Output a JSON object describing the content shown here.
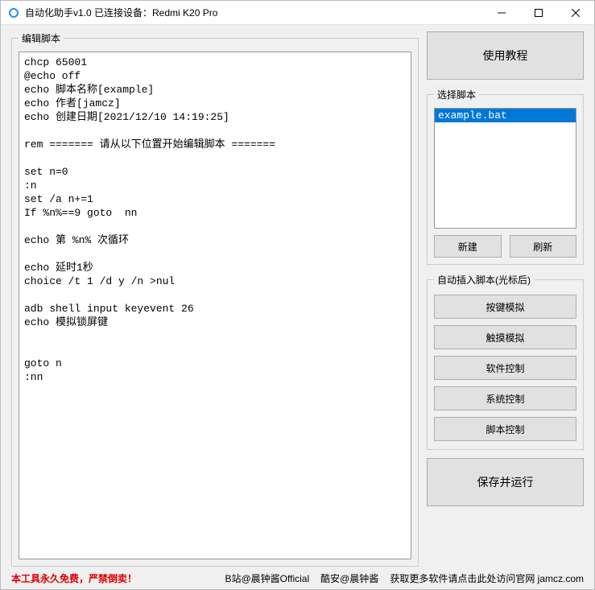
{
  "title": "自动化助手v1.0  已连接设备：Redmi K20 Pro",
  "editor": {
    "legend": "编辑脚本",
    "content": "chcp 65001\n@echo off\necho 脚本名称[example]\necho 作者[jamcz]\necho 创建日期[2021/12/10 14:19:25]\n\nrem ======= 请从以下位置开始编辑脚本 =======\n\nset n=0\n:n\nset /a n+=1\nIf %n%==9 goto  nn\n\necho 第 %n% 次循环\n\necho 延时1秒\nchoice /t 1 /d y /n >nul\n\nadb shell input keyevent 26\necho 模拟锁屏键\n\n\ngoto n\n:nn\n"
  },
  "tutorial_btn": "使用教程",
  "select_script": {
    "legend": "选择脚本",
    "items": [
      "example.bat"
    ],
    "new_btn": "新建",
    "refresh_btn": "刷新"
  },
  "insert": {
    "legend": "自动插入脚本(光标后)",
    "btns": [
      "按键模拟",
      "触摸模拟",
      "软件控制",
      "系统控制",
      "脚本控制"
    ]
  },
  "save_run_btn": "保存并运行",
  "footer": {
    "warning": "本工具永久免费，严禁倒卖！",
    "bilibili": "B站@晨钟酱Official",
    "coolapk": "酷安@晨钟酱",
    "more": "获取更多软件请点击此处访问官网 jamcz.com"
  }
}
